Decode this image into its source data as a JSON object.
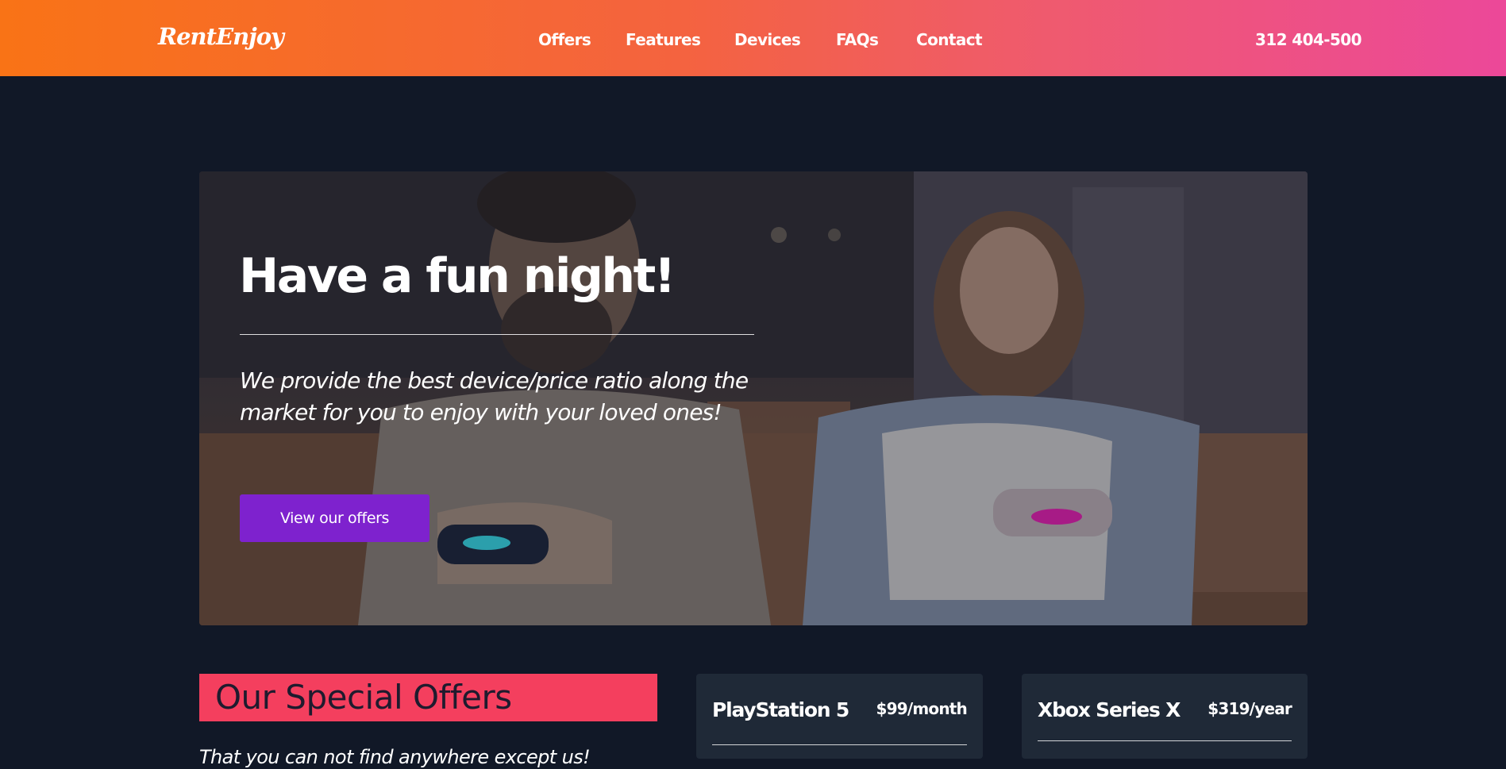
{
  "header": {
    "logo": "RentEnjoy",
    "nav": [
      "Offers",
      "Features",
      "Devices",
      "FAQs",
      "Contact"
    ],
    "phone": "312 404-500",
    "gradient_colors": [
      "#f97316",
      "#ec4899"
    ]
  },
  "hero": {
    "title": "Have a fun night!",
    "subtitle": "We provide the best device/price ratio along the market for you to enjoy with your loved ones!",
    "button_label": "View our offers",
    "button_color": "#7e22ce"
  },
  "offers": {
    "heading": "Our Special Offers",
    "heading_bg": "#f43f5e",
    "tagline": "That you can not find anywhere except us!",
    "cards": [
      {
        "name": "PlayStation 5",
        "price": "$99/month"
      },
      {
        "name": "Xbox Series X",
        "price": "$319/year"
      }
    ]
  },
  "colors": {
    "page_bg": "#111827",
    "card_bg": "#1f2937"
  }
}
